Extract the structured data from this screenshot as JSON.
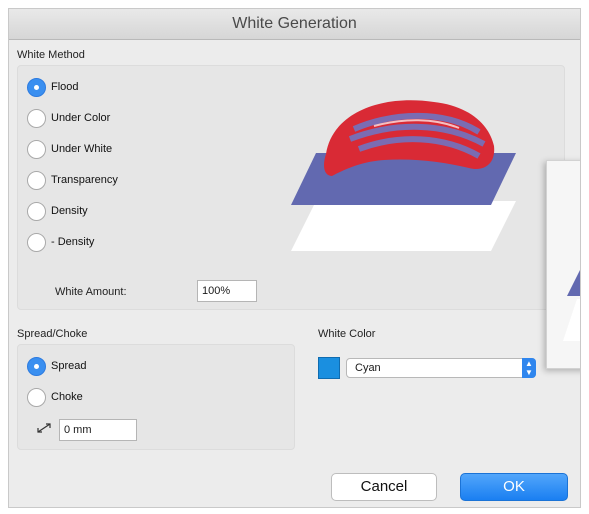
{
  "window": {
    "title": "White Generation"
  },
  "white_method": {
    "section_label": "White Method",
    "options": [
      {
        "label": "Flood",
        "selected": true
      },
      {
        "label": "Under Color",
        "selected": false
      },
      {
        "label": "Under White",
        "selected": false
      },
      {
        "label": "Transparency",
        "selected": false
      },
      {
        "label": "Density",
        "selected": false
      },
      {
        "label": "- Density",
        "selected": false
      }
    ],
    "amount_label": "White Amount:",
    "amount_value": "100%"
  },
  "spread_choke": {
    "section_label": "Spread/Choke",
    "options": [
      {
        "label": "Spread",
        "selected": true
      },
      {
        "label": "Choke",
        "selected": false
      }
    ],
    "distance_icon": "distance-arrows-icon",
    "distance_value": "0 mm"
  },
  "white_color": {
    "section_label": "White Color",
    "swatch_color": "#1a8fe0",
    "selected": "Cyan"
  },
  "buttons": {
    "cancel": "Cancel",
    "ok": "OK"
  },
  "colors": {
    "accent": "#2f86ee",
    "plane": "#6269b0",
    "shape_red": "#d92a35"
  }
}
